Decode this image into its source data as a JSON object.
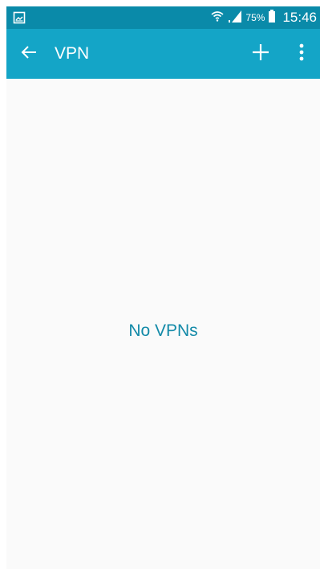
{
  "status_bar": {
    "battery_percent": "75%",
    "time": "15:46",
    "icons": [
      "gallery-notification-icon",
      "wifi-icon",
      "signal-icon",
      "battery-icon"
    ]
  },
  "app_bar": {
    "title": "VPN",
    "back_icon": "arrow-back-icon",
    "add_icon": "plus-icon",
    "more_icon": "more-vert-icon"
  },
  "content": {
    "empty_message": "No VPNs"
  },
  "colors": {
    "status_bar": "#0a8aa9",
    "app_bar": "#14a5c7",
    "background": "#fafafa",
    "accent_text": "#138aa8"
  }
}
